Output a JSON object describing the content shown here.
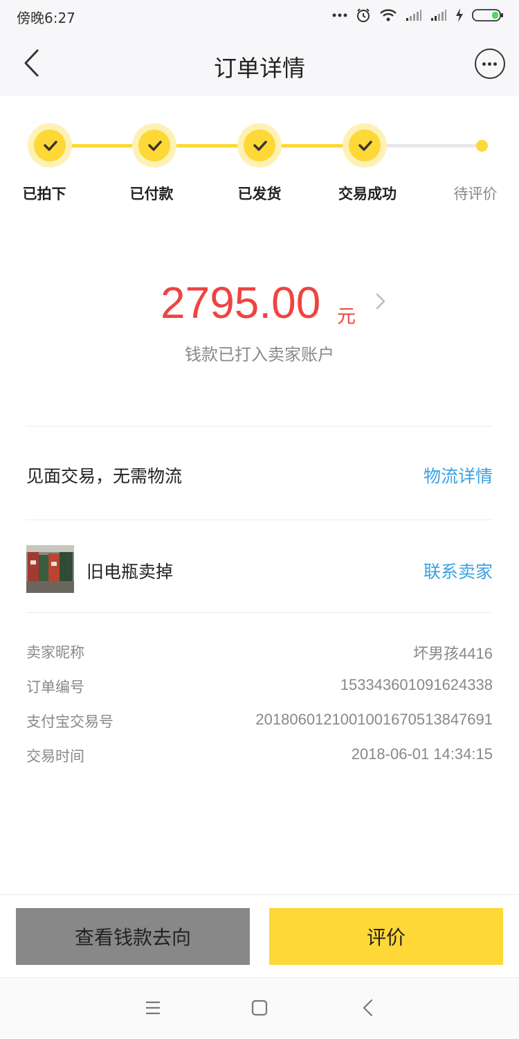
{
  "status_bar": {
    "time": "傍晚6:27"
  },
  "header": {
    "title": "订单详情"
  },
  "progress": {
    "steps": [
      {
        "label": "已拍下",
        "state": "done"
      },
      {
        "label": "已付款",
        "state": "done"
      },
      {
        "label": "已发货",
        "state": "done"
      },
      {
        "label": "交易成功",
        "state": "done"
      },
      {
        "label": "待评价",
        "state": "pending"
      }
    ],
    "accent_color": "#fdd836"
  },
  "amount": {
    "value": "2795.00",
    "unit": "元",
    "status": "钱款已打入卖家账户",
    "color": "#ee4442"
  },
  "logistics": {
    "text": "见面交易，无需物流",
    "link": "物流详情"
  },
  "item": {
    "title": "旧电瓶卖掉",
    "contact": "联系卖家"
  },
  "details": [
    {
      "label": "卖家昵称",
      "value": "坏男孩4416"
    },
    {
      "label": "订单编号",
      "value": "153343601091624338"
    },
    {
      "label": "支付宝交易号",
      "value": "2018060121001001670513847691"
    },
    {
      "label": "交易时间",
      "value": "2018-06-01 14:34:15"
    }
  ],
  "actions": {
    "money_flow": "查看钱款去向",
    "review": "评价"
  },
  "link_color": "#3aa2e0"
}
